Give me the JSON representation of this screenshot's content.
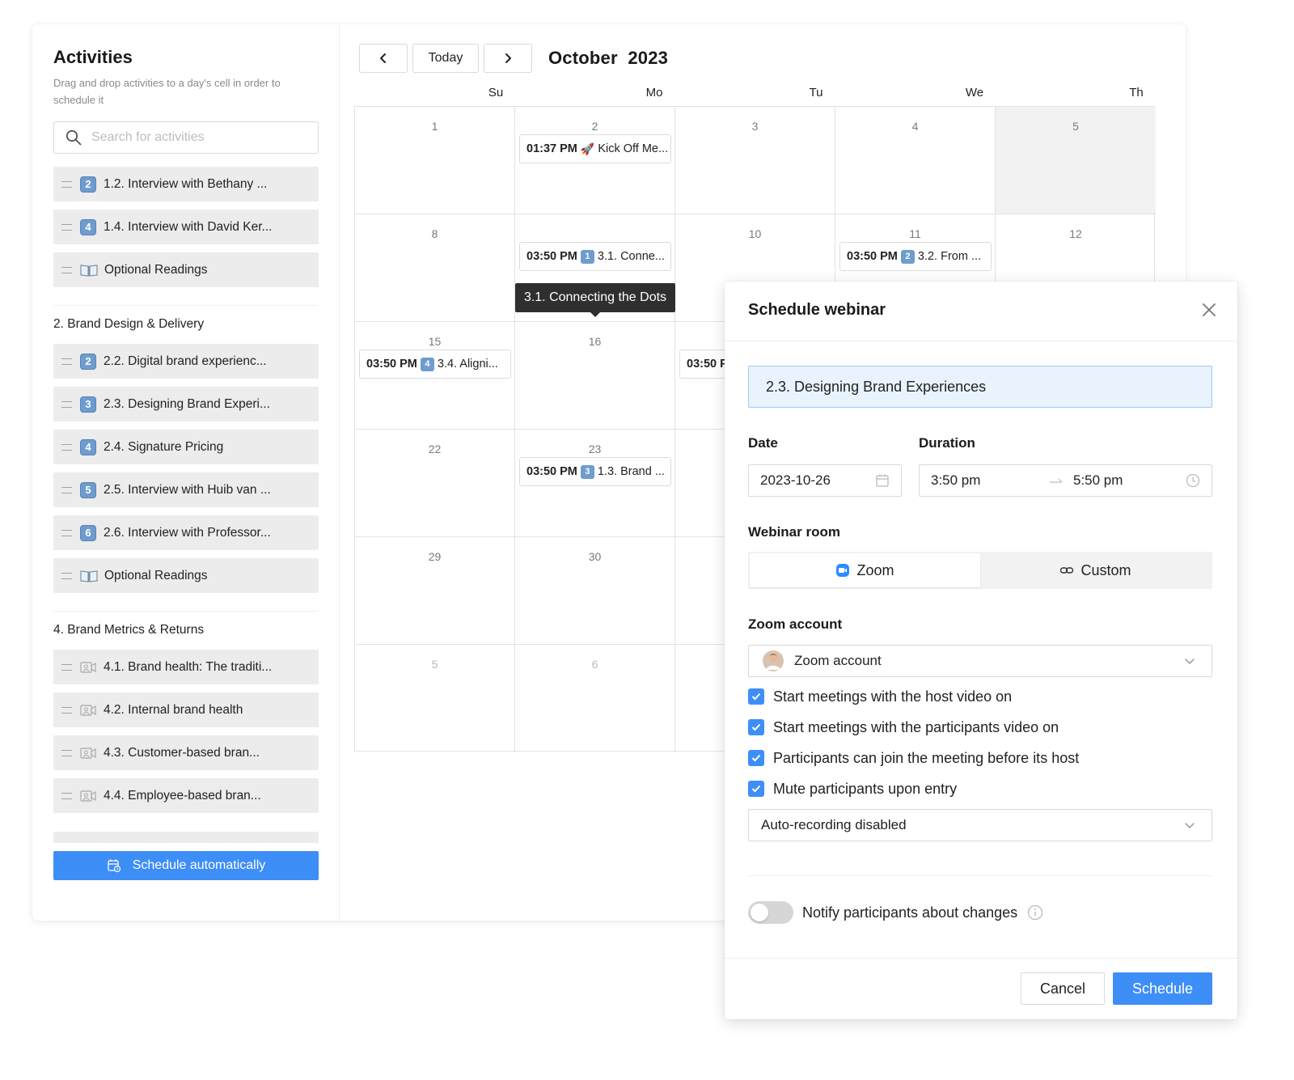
{
  "sidebar": {
    "title": "Activities",
    "description": "Drag and drop activities to a day's cell in order to schedule it",
    "search_placeholder": "Search for activities",
    "group1": [
      {
        "badge": "2",
        "label": "1.2. Interview with Bethany ...",
        "icon": "number-badge"
      },
      {
        "badge": "4",
        "label": "1.4. Interview with David Ker...",
        "icon": "number-badge"
      },
      {
        "badge": "",
        "label": "Optional Readings",
        "icon": "book-icon"
      }
    ],
    "section2_title": "2. Brand Design & Delivery",
    "group2": [
      {
        "badge": "2",
        "label": "2.2. Digital brand experienc...",
        "icon": "number-badge"
      },
      {
        "badge": "3",
        "label": "2.3. Designing Brand Experi...",
        "icon": "number-badge"
      },
      {
        "badge": "4",
        "label": "2.4. Signature Pricing",
        "icon": "number-badge"
      },
      {
        "badge": "5",
        "label": "2.5. Interview with Huib van ...",
        "icon": "number-badge"
      },
      {
        "badge": "6",
        "label": "2.6. Interview with Professor...",
        "icon": "number-badge"
      },
      {
        "badge": "",
        "label": "Optional Readings",
        "icon": "book-icon"
      }
    ],
    "section4_title": "4. Brand Metrics & Returns",
    "group4": [
      {
        "label": "4.1. Brand health: The traditi...",
        "icon": "video-icon"
      },
      {
        "label": "4.2. Internal brand health",
        "icon": "video-icon"
      },
      {
        "label": "4.3. Customer-based bran...",
        "icon": "video-icon"
      },
      {
        "label": "4.4. Employee-based bran...",
        "icon": "video-icon"
      }
    ],
    "schedule_auto_label": "Schedule automatically"
  },
  "calendar": {
    "today_label": "Today",
    "month_title": "October  2023",
    "weekdays": [
      "Su",
      "Mo",
      "Tu",
      "We",
      "Th"
    ],
    "days": {
      "d1": "1",
      "d2": "2",
      "d3": "3",
      "d4": "4",
      "d5": "5",
      "d8": "8",
      "d10": "10",
      "d11": "11",
      "d12": "12",
      "d15": "15",
      "d16": "16",
      "d22": "22",
      "d23": "23",
      "d29": "29",
      "d30": "30",
      "n5": "5",
      "n6": "6"
    },
    "events": {
      "e2": {
        "time": "01:37 PM",
        "emoji": "🚀",
        "title": "Kick Off Me..."
      },
      "e9": {
        "time": "03:50 PM",
        "badge": "1",
        "title": "3.1. Conne..."
      },
      "e11": {
        "time": "03:50 PM",
        "badge": "2",
        "title": "3.2. From ..."
      },
      "e15": {
        "time": "03:50 PM",
        "badge": "4",
        "title": "3.4. Aligni..."
      },
      "e17": {
        "time": "03:50 P"
      },
      "e23": {
        "time": "03:50 PM",
        "badge": "3",
        "title": "1.3. Brand ..."
      }
    },
    "tooltip": "3.1. Connecting the Dots"
  },
  "modal": {
    "title": "Schedule webinar",
    "activity": "2.3. Designing Brand Experiences",
    "date_label": "Date",
    "date_value": "2023-10-26",
    "duration_label": "Duration",
    "start_time": "3:50 pm",
    "end_time": "5:50 pm",
    "room_label": "Webinar room",
    "room_zoom": "Zoom",
    "room_custom": "Custom",
    "zoom_account_label": "Zoom account",
    "zoom_account_value": "Zoom account",
    "options": [
      "Start meetings with the host video on",
      "Start meetings with the participants video on",
      "Participants can join the meeting before its host",
      "Mute participants upon entry"
    ],
    "recording_value": "Auto-recording disabled",
    "notify_label": "Notify participants about changes",
    "cancel_label": "Cancel",
    "schedule_label": "Schedule"
  },
  "colors": {
    "accent": "#3e8ef7",
    "badge": "#6e9ccf",
    "selected_bg": "#e8f3fd"
  }
}
